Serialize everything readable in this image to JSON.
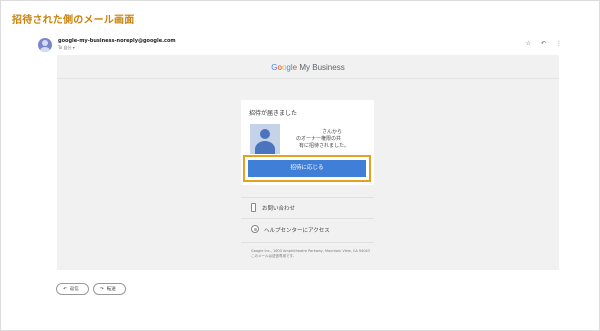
{
  "page": {
    "heading": "招待された側のメール画面"
  },
  "email_header": {
    "sender_email": "google-my-business-noreply@google.com",
    "to_line": "To 自分 ▾",
    "icons": [
      "star-icon",
      "reply-icon",
      "more-icon"
    ],
    "star_glyph": "☆",
    "reply_glyph": "↶",
    "more_glyph": "⋮"
  },
  "brand": {
    "google_letters": [
      "G",
      "o",
      "o",
      "g",
      "l",
      "e"
    ],
    "product": "My Business",
    "colors": {
      "blue": "#4285f4",
      "red": "#ea4335",
      "yellow": "#fbbc05",
      "green": "#34a853"
    }
  },
  "invite_card": {
    "title": "招待が届きました",
    "line1": "さんから",
    "line2": "のオーナー権限の共",
    "line3": "有に招待されました。",
    "accept_label": "招待に応じる",
    "accept_color": "#3f7fd8",
    "highlight_color": "#e8a023"
  },
  "links": {
    "contact_label": "お問い合わせ",
    "help_label": "ヘルプセンターにアクセス"
  },
  "footer": {
    "address": "Google Inc., 1600 Amphitheatre Parkway, Mountain View, CA 94043",
    "note": "このメールは送信専用です。"
  },
  "actions": {
    "reply_label": "返信",
    "reply_glyph": "↶",
    "forward_label": "転送",
    "forward_glyph": "↷"
  }
}
